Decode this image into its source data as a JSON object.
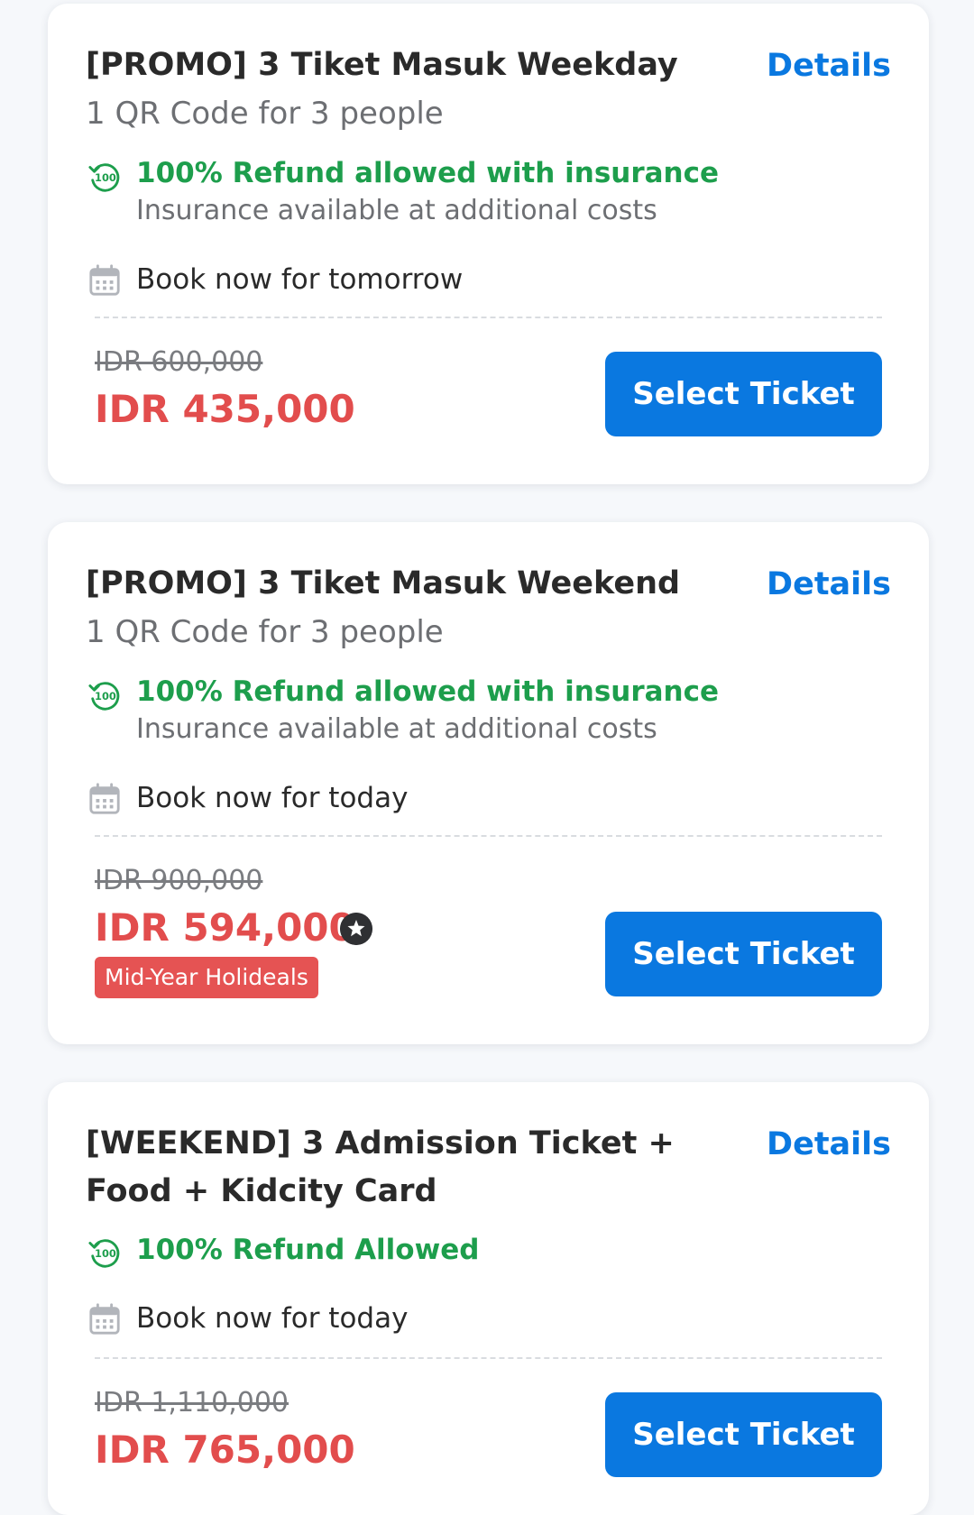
{
  "tickets": [
    {
      "title": "[PROMO] 3 Tiket Masuk Weekday",
      "subtitle": "1 QR Code for 3 people",
      "details_label": "Details",
      "refund_title": "100% Refund allowed with insurance",
      "refund_note": "Insurance available at additional costs",
      "book_text": "Book now for tomorrow",
      "original_price": "IDR 600,000",
      "price": "IDR 435,000",
      "button_label": "Select Ticket"
    },
    {
      "title": "[PROMO] 3 Tiket Masuk Weekend",
      "subtitle": "1 QR Code for 3 people",
      "details_label": "Details",
      "refund_title": "100% Refund allowed with insurance",
      "refund_note": "Insurance available at additional costs",
      "book_text": "Book now for today",
      "original_price": "IDR 900,000",
      "price": "IDR 594,000",
      "promo_tag": "Mid-Year Holideals",
      "button_label": "Select Ticket"
    },
    {
      "title": "[WEEKEND] 3 Admission Ticket + Food + Kidcity Card",
      "details_label": "Details",
      "refund_title": "100% Refund Allowed",
      "book_text": "Book now for today",
      "original_price": "IDR 1,110,000",
      "price": "IDR 765,000",
      "button_label": "Select Ticket"
    }
  ],
  "icons": {
    "refund": "refund-100-icon",
    "calendar": "calendar-icon",
    "star_badge": "star-badge-icon"
  },
  "colors": {
    "accent_blue": "#0a78e0",
    "refund_green": "#1d9e4c",
    "price_red": "#e24d4d",
    "promo_tag_red": "#e55353",
    "page_background": "#f6f8fb"
  }
}
